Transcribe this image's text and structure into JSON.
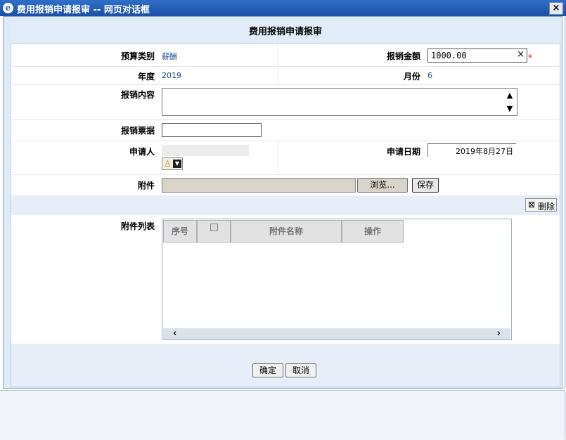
{
  "window": {
    "title": "费用报销申请报审 -- 网页对话框",
    "close_label": "×",
    "ie_icon": "e"
  },
  "form": {
    "header": "费用报销申请报审",
    "budget_type": {
      "label": "预算类别",
      "value": "薪酬"
    },
    "amount": {
      "label": "报销金额",
      "value": "1000.00",
      "clear": "×",
      "required": "*"
    },
    "year": {
      "label": "年度",
      "value": "2019"
    },
    "month": {
      "label": "月份",
      "value": "6"
    },
    "content": {
      "label": "报销内容",
      "value": ""
    },
    "invoice": {
      "label": "报销票据",
      "value": ""
    },
    "applicant": {
      "label": "申请人",
      "value": "",
      "picker_icon": "person-icon"
    },
    "apply_date": {
      "label": "申请日期",
      "value": "2019年8月27日"
    },
    "attachment": {
      "label": "附件",
      "browse": "浏览...",
      "save": "保存"
    },
    "delete": {
      "label": "删除",
      "icon": "delete-icon"
    },
    "attach_list": {
      "label": "附件列表",
      "columns": [
        "序号",
        "",
        "附件名称",
        "操作"
      ],
      "rows": []
    },
    "buttons": {
      "ok": "确定",
      "cancel": "取消"
    }
  }
}
